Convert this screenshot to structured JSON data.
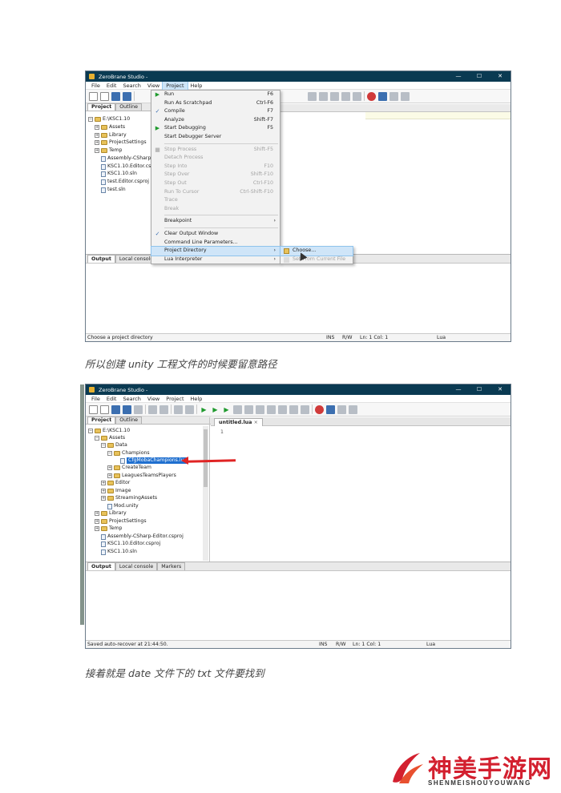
{
  "window1": {
    "title": "ZeroBrane Studio -",
    "controls": {
      "minimize": "—",
      "maximize": "☐",
      "close": "✕"
    },
    "menubar": [
      "File",
      "Edit",
      "Search",
      "View",
      "Project",
      "Help"
    ],
    "active_menu": "Project",
    "left_tabs": [
      "Project",
      "Outline"
    ],
    "tree": [
      {
        "label": "E:\\KSC1.10",
        "kind": "folder",
        "expander": "−"
      },
      {
        "label": "Assets",
        "kind": "folder",
        "expander": "+"
      },
      {
        "label": "Library",
        "kind": "folder",
        "expander": "+"
      },
      {
        "label": "ProjectSettings",
        "kind": "folder",
        "expander": "+"
      },
      {
        "label": "Temp",
        "kind": "folder",
        "expander": "+"
      },
      {
        "label": "Assembly-CSharp",
        "kind": "file"
      },
      {
        "label": "KSC1.10.Editor.csp",
        "kind": "file"
      },
      {
        "label": "KSC1.10.sln",
        "kind": "file"
      },
      {
        "label": "test.Editor.csproj",
        "kind": "file"
      },
      {
        "label": "test.sln",
        "kind": "file"
      }
    ],
    "project_menu": [
      {
        "label": "Run",
        "shortcut": "F6",
        "icon": "run-icon",
        "glyph": "▶",
        "disabled": false
      },
      {
        "label": "Run As Scratchpad",
        "shortcut": "Ctrl-F6",
        "disabled": false
      },
      {
        "label": "Compile",
        "shortcut": "F7",
        "icon": "compile-icon",
        "glyph": "✓",
        "disabled": false
      },
      {
        "label": "Analyze",
        "shortcut": "Shift-F7",
        "disabled": false
      },
      {
        "label": "Start Debugging",
        "shortcut": "F5",
        "icon": "debug-icon",
        "glyph": "▶",
        "disabled": false
      },
      {
        "label": "Start Debugger Server",
        "shortcut": "",
        "disabled": false
      },
      {
        "sep": true
      },
      {
        "label": "Stop Process",
        "shortcut": "Shift-F5",
        "icon": "stop-icon",
        "glyph": "■",
        "disabled": true
      },
      {
        "label": "Detach Process",
        "shortcut": "",
        "disabled": true
      },
      {
        "label": "Step Into",
        "shortcut": "F10",
        "disabled": true
      },
      {
        "label": "Step Over",
        "shortcut": "Shift-F10",
        "disabled": true
      },
      {
        "label": "Step Out",
        "shortcut": "Ctrl-F10",
        "disabled": true
      },
      {
        "label": "Run To Cursor",
        "shortcut": "Ctrl-Shift-F10",
        "disabled": true
      },
      {
        "label": "Trace",
        "shortcut": "",
        "disabled": true
      },
      {
        "label": "Break",
        "shortcut": "",
        "disabled": true
      },
      {
        "sep": true
      },
      {
        "label": "Breakpoint",
        "shortcut": "",
        "submenu": true,
        "disabled": false
      },
      {
        "sep": true
      },
      {
        "label": "Clear Output Window",
        "shortcut": "",
        "icon": "check-icon",
        "glyph": "✓",
        "disabled": false
      },
      {
        "label": "Command Line Parameters...",
        "shortcut": "",
        "disabled": false
      },
      {
        "label": "Project Directory",
        "shortcut": "",
        "submenu": true,
        "highlighted": true,
        "disabled": false
      },
      {
        "label": "Lua Interpreter",
        "shortcut": "",
        "submenu": true,
        "disabled": false
      }
    ],
    "submenu": [
      {
        "label": "Choose...",
        "highlighted": true,
        "disabled": false
      },
      {
        "label": "Set From Current File",
        "disabled": true
      }
    ],
    "output_tabs": [
      "Output",
      "Local console"
    ],
    "status": {
      "text": "Choose a project directory",
      "ins": "INS",
      "rw": "R/W",
      "pos": "Ln: 1 Col: 1",
      "lang": "Lua"
    }
  },
  "caption1": "所以创建 unity 工程文件的时候要留意路径",
  "window2": {
    "title": "ZeroBrane Studio -",
    "controls": {
      "minimize": "—",
      "maximize": "☐",
      "close": "✕"
    },
    "menubar": [
      "File",
      "Edit",
      "Search",
      "View",
      "Project",
      "Help"
    ],
    "left_tabs": [
      "Project",
      "Outline"
    ],
    "editor_tab": "untitled.lua",
    "editor_tab_close": "×",
    "line_number": "1",
    "tree": [
      {
        "label": "E:\\KSC1.10",
        "kind": "folder",
        "expander": "−",
        "depth": 0
      },
      {
        "label": "Assets",
        "kind": "folder",
        "expander": "−",
        "depth": 1
      },
      {
        "label": "Data",
        "kind": "folder",
        "expander": "−",
        "depth": 2
      },
      {
        "label": "Champions",
        "kind": "folder",
        "expander": "−",
        "depth": 3
      },
      {
        "label": "CfgMobaChampions.lua",
        "kind": "file",
        "depth": 4,
        "selected": true
      },
      {
        "label": "CreateTeam",
        "kind": "folder",
        "expander": "+",
        "depth": 3
      },
      {
        "label": "LeaguesTeamsPlayers",
        "kind": "folder",
        "expander": "+",
        "depth": 3
      },
      {
        "label": "Editor",
        "kind": "folder",
        "expander": "+",
        "depth": 2
      },
      {
        "label": "Image",
        "kind": "folder",
        "expander": "+",
        "depth": 2
      },
      {
        "label": "StreamingAssets",
        "kind": "folder",
        "expander": "+",
        "depth": 2
      },
      {
        "label": "Mod.unity",
        "kind": "file",
        "depth": 2
      },
      {
        "label": "Library",
        "kind": "folder",
        "expander": "+",
        "depth": 1
      },
      {
        "label": "ProjectSettings",
        "kind": "folder",
        "expander": "+",
        "depth": 1
      },
      {
        "label": "Temp",
        "kind": "folder",
        "expander": "+",
        "depth": 1
      },
      {
        "label": "Assembly-CSharp-Editor.csproj",
        "kind": "file",
        "depth": 1
      },
      {
        "label": "KSC1.10.Editor.csproj",
        "kind": "file",
        "depth": 1
      },
      {
        "label": "KSC1.10.sln",
        "kind": "file",
        "depth": 1
      }
    ],
    "output_tabs": [
      "Output",
      "Local console",
      "Markers"
    ],
    "status": {
      "text": "Saved auto-recover at 21:44:50.",
      "ins": "INS",
      "rw": "R/W",
      "pos": "Ln: 1 Col: 1",
      "lang": "Lua"
    }
  },
  "caption2": "接着就是 date 文件下的 txt 文件要找到",
  "logo": {
    "name": "神美手游网",
    "sub": "SHENMEISHOUYOUWANG"
  },
  "colors": {
    "titlebar": "#0a3a52",
    "highlight": "#cfe5f8",
    "selection": "#1f6fcf",
    "arrow": "#e02424",
    "brand": "#d3202f"
  }
}
